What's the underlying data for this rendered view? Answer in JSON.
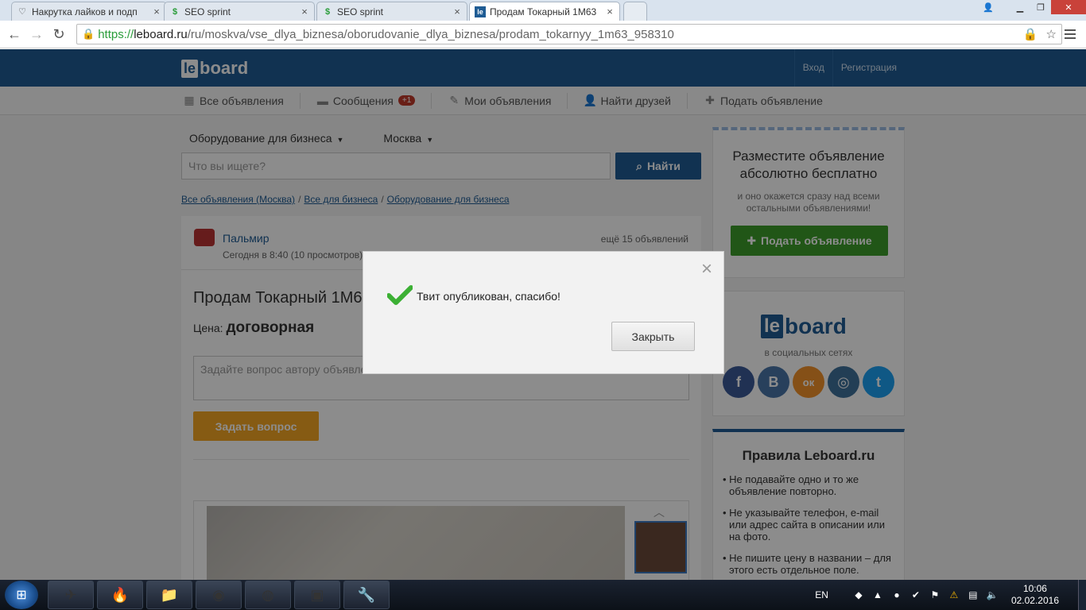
{
  "browser": {
    "tabs": [
      {
        "title": "Накрутка лайков и подп",
        "icon": "heart-icon",
        "active": false
      },
      {
        "title": "SEO sprint",
        "icon": "seosprint-icon",
        "active": false
      },
      {
        "title": "SEO sprint",
        "icon": "seosprint-icon",
        "active": false
      },
      {
        "title": "Продам Токарный 1М63",
        "icon": "leboard-icon",
        "active": true
      }
    ],
    "url": {
      "scheme": "https://",
      "host": "leboard.ru",
      "path": "/ru/moskva/vse_dlya_biznesa/oborudovanie_dlya_biznesa/prodam_tokarnyy_1m63_958310"
    }
  },
  "site": {
    "logo": {
      "le": "le",
      "board": "board"
    },
    "auth": {
      "login": "Вход",
      "register": "Регистрация"
    },
    "subnav": [
      {
        "label": "Все объявления",
        "icon": "grid-icon"
      },
      {
        "label": "Сообщения",
        "icon": "chat-icon",
        "badge": "+1"
      },
      {
        "label": "Мои объявления",
        "icon": "pencil-icon"
      },
      {
        "label": "Найти друзей",
        "icon": "add-user-icon"
      },
      {
        "label": "Подать объявление",
        "icon": "plus-icon"
      }
    ],
    "filters": {
      "category": "Оборудование для бизнеса",
      "city": "Москва"
    },
    "search": {
      "placeholder": "Что вы ищете?",
      "button": "Найти"
    },
    "breadcrumbs": [
      "Все объявления (Москва)",
      "Все для бизнеса",
      "Оборудование для бизнеса"
    ]
  },
  "ad": {
    "seller": "Пальмир",
    "date": "Сегодня в 8:40 (10 просмотров)",
    "more_ads": "ещё 15 объявлений",
    "title": "Продам Токарный 1М63",
    "price_label": "Цена:",
    "price_value": "договорная",
    "question_placeholder": "Задайте вопрос автору объявления",
    "ask_button": "Задать вопрос"
  },
  "sidebar": {
    "promo_title": "Разместите объявление абсолютно бесплатно",
    "promo_text": "и оно окажется сразу над всеми остальными объявлениями!",
    "promo_button": "Подать объявление",
    "social_caption": "в социальных сетях",
    "socials": [
      {
        "name": "facebook",
        "glyph": "f",
        "color": "#3b5998"
      },
      {
        "name": "vkontakte",
        "glyph": "В",
        "color": "#4a76a8"
      },
      {
        "name": "odnoklassniki",
        "glyph": "ок",
        "color": "#f2922a"
      },
      {
        "name": "instagram",
        "glyph": "◎",
        "color": "#3f729b"
      },
      {
        "name": "twitter",
        "glyph": "t",
        "color": "#1da1f2"
      }
    ],
    "rules_title": "Правила Leboard.ru",
    "rules": [
      "Не подавайте одно и то же объявление повторно.",
      "Не указывайте телефон, e-mail или адрес сайта в описании или на фото.",
      "Не пишите цену в названии – для этого есть отдельное поле."
    ]
  },
  "modal": {
    "message": "Твит опубликован, спасибо!",
    "close_button": "Закрыть"
  },
  "taskbar": {
    "language": "EN",
    "time": "10:06",
    "date": "02.02.2016"
  },
  "colors": {
    "brand": "#1f5c94",
    "ask_button": "#f5a623",
    "promo_button": "#3c9d2a",
    "check": "#3cb034"
  }
}
